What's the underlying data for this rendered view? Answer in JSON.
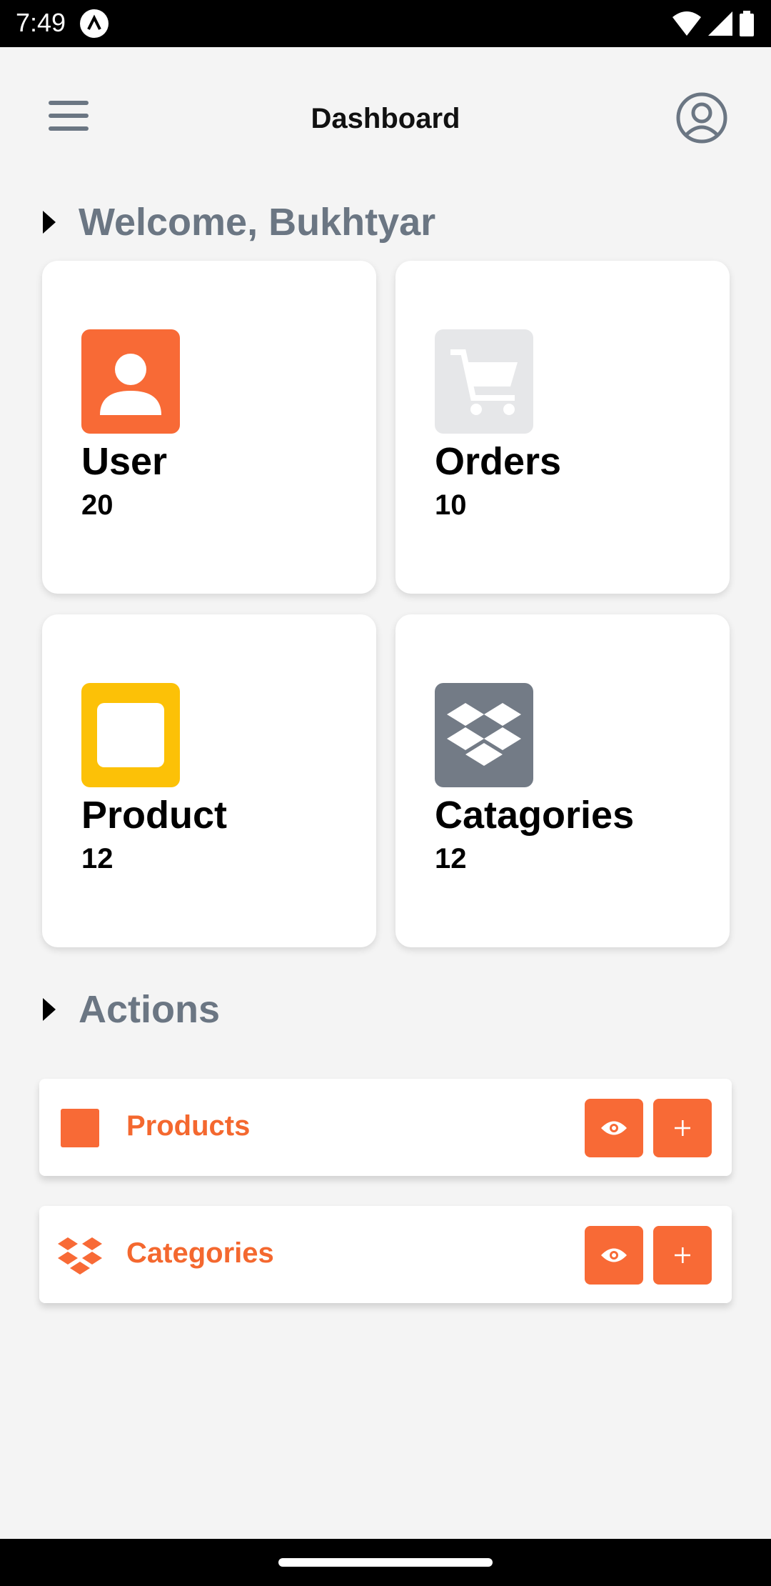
{
  "status_bar": {
    "time": "7:49"
  },
  "header": {
    "title": "Dashboard"
  },
  "welcome": {
    "text": "Welcome, Bukhtyar"
  },
  "stats": [
    {
      "label": "User",
      "count": "20",
      "icon": "user-icon",
      "color": "#f86a36"
    },
    {
      "label": "Orders",
      "count": "10",
      "icon": "cart-icon",
      "color": "#e6e7e9"
    },
    {
      "label": "Product",
      "count": "12",
      "icon": "square-icon",
      "color": "#fcc107"
    },
    {
      "label": "Catagories",
      "count": "12",
      "icon": "dropbox-icon",
      "color": "#737b86"
    }
  ],
  "actions_section": {
    "title": "Actions"
  },
  "actions": [
    {
      "label": "Products",
      "icon": "square-icon"
    },
    {
      "label": "Categories",
      "icon": "dropbox-icon"
    }
  ],
  "colors": {
    "accent": "#f86a36",
    "heading_gray": "#6b7683"
  }
}
